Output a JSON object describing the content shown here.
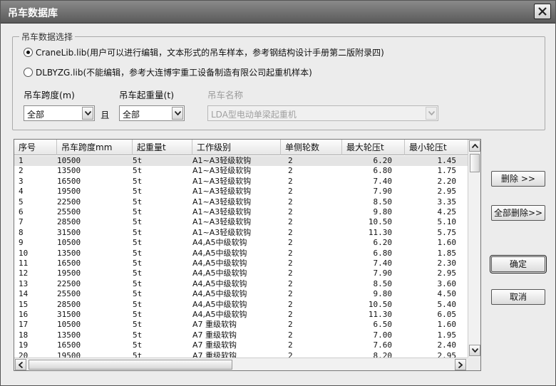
{
  "window": {
    "title": "吊车数据库"
  },
  "group": {
    "title": "吊车数据选择",
    "radios": [
      {
        "label": "CraneLib.lib(用户可以进行编辑，文本形式的吊车样本，参考钢结构设计手册第二版附录四)",
        "checked": true
      },
      {
        "label": "DLBYZG.lib(不能编辑，参考大连博宇重工设备制造有限公司起重机样本)",
        "checked": false
      }
    ],
    "span_label": "吊车跨度(m)",
    "span_value": "全部",
    "and_label": "且",
    "capacity_label": "吊车起重量(t)",
    "capacity_value": "全部",
    "name_label": "吊车名称",
    "name_value": "LDA型电动单梁起重机"
  },
  "table": {
    "columns": [
      "序号",
      "吊车跨度mm",
      "起重量t",
      "工作级别",
      "单侧轮数",
      "最大轮压t",
      "最小轮压t"
    ],
    "rows": [
      [
        "1",
        "10500",
        "5t",
        "A1~A3轻级软钩",
        "2",
        "6.20",
        "1.45"
      ],
      [
        "2",
        "13500",
        "5t",
        "A1~A3轻级软钩",
        "2",
        "6.80",
        "1.75"
      ],
      [
        "3",
        "16500",
        "5t",
        "A1~A3轻级软钩",
        "2",
        "7.40",
        "2.20"
      ],
      [
        "4",
        "19500",
        "5t",
        "A1~A3轻级软钩",
        "2",
        "7.90",
        "2.95"
      ],
      [
        "5",
        "22500",
        "5t",
        "A1~A3轻级软钩",
        "2",
        "8.50",
        "3.35"
      ],
      [
        "6",
        "25500",
        "5t",
        "A1~A3轻级软钩",
        "2",
        "9.80",
        "4.25"
      ],
      [
        "7",
        "28500",
        "5t",
        "A1~A3轻级软钩",
        "2",
        "10.50",
        "5.10"
      ],
      [
        "8",
        "31500",
        "5t",
        "A1~A3轻级软钩",
        "2",
        "11.30",
        "5.75"
      ],
      [
        "9",
        "10500",
        "5t",
        "A4,A5中级软钩",
        "2",
        "6.20",
        "1.60"
      ],
      [
        "10",
        "13500",
        "5t",
        "A4,A5中级软钩",
        "2",
        "6.80",
        "1.85"
      ],
      [
        "11",
        "16500",
        "5t",
        "A4,A5中级软钩",
        "2",
        "7.40",
        "2.30"
      ],
      [
        "12",
        "19500",
        "5t",
        "A4,A5中级软钩",
        "2",
        "7.90",
        "2.95"
      ],
      [
        "13",
        "22500",
        "5t",
        "A4,A5中级软钩",
        "2",
        "8.50",
        "3.60"
      ],
      [
        "14",
        "25500",
        "5t",
        "A4,A5中级软钩",
        "2",
        "9.80",
        "4.50"
      ],
      [
        "15",
        "28500",
        "5t",
        "A4,A5中级软钩",
        "2",
        "10.50",
        "5.40"
      ],
      [
        "16",
        "31500",
        "5t",
        "A4,A5中级软钩",
        "2",
        "11.30",
        "6.05"
      ],
      [
        "17",
        "10500",
        "5t",
        "A7 重级软钩",
        "2",
        "6.50",
        "1.60"
      ],
      [
        "18",
        "13500",
        "5t",
        "A7 重级软钩",
        "2",
        "7.00",
        "1.95"
      ],
      [
        "19",
        "16500",
        "5t",
        "A7 重级软钩",
        "2",
        "7.60",
        "2.40"
      ],
      [
        "20",
        "19500",
        "5t",
        "A7 重级软钩",
        "2",
        "8.20",
        "2.95"
      ]
    ]
  },
  "buttons": {
    "delete": "删除 >>",
    "delete_all": "全部删除>>",
    "ok": "确定",
    "cancel": "取消"
  }
}
